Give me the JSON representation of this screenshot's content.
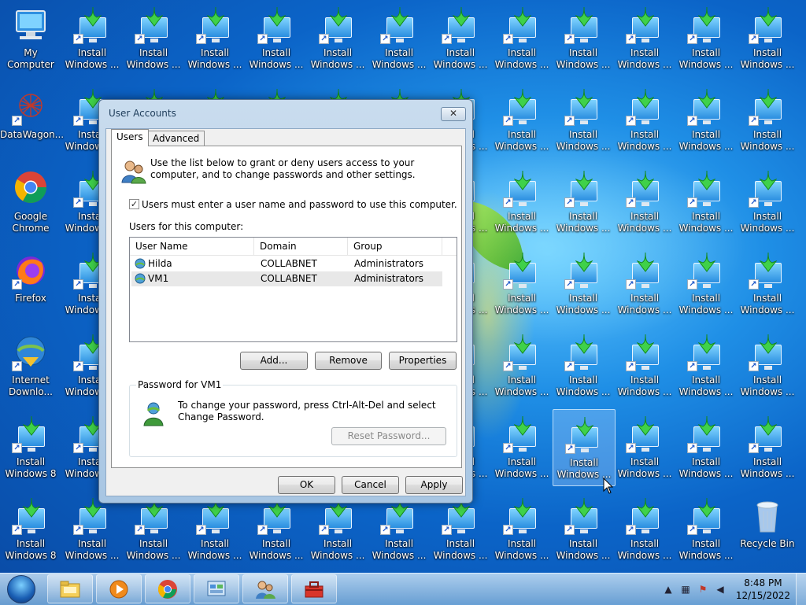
{
  "desktop": {
    "icons": [
      {
        "id": "my-computer",
        "label": "My Computer",
        "col": 0,
        "row": 0,
        "type": "computer"
      },
      {
        "id": "datawagon",
        "label": "DataWagon...",
        "col": 0,
        "row": 1,
        "type": "datawagon"
      },
      {
        "id": "google-chrome",
        "label": "Google Chrome",
        "col": 0,
        "row": 2,
        "type": "chrome"
      },
      {
        "id": "firefox",
        "label": "Firefox",
        "col": 0,
        "row": 3,
        "type": "firefox"
      },
      {
        "id": "internet-download",
        "label": "Internet Downlo...",
        "col": 0,
        "row": 4,
        "type": "idm"
      },
      {
        "id": "install-win8-a",
        "label": "Install Windows 8",
        "col": 0,
        "row": 5,
        "type": "install"
      },
      {
        "id": "install-win8-b",
        "label": "Install Windows 8",
        "col": 0,
        "row": 6,
        "type": "install",
        "shortcut": true
      },
      {
        "id": "recycle-bin",
        "label": "Recycle Bin",
        "col": 12,
        "row": 6,
        "type": "recycle"
      }
    ],
    "install_label": "Install Windows ...",
    "selected_icon": {
      "col": 9,
      "row": 5
    }
  },
  "dialog": {
    "title": "User Accounts",
    "close_glyph": "✕",
    "tabs": [
      {
        "label": "Users",
        "active": true
      },
      {
        "label": "Advanced",
        "active": false
      }
    ],
    "intro_text": "Use the list below to grant or deny users access to your computer, and to change passwords and other settings.",
    "must_login_checkbox": {
      "label": "Users must enter a user name and password to use this computer.",
      "checked": true,
      "glyph": "✓"
    },
    "users_list_label": "Users for this computer:",
    "columns": [
      "User Name",
      "Domain",
      "Group"
    ],
    "users": [
      {
        "name": "Hilda",
        "domain": "COLLABNET",
        "group": "Administrators",
        "selected": false
      },
      {
        "name": "VM1",
        "domain": "COLLABNET",
        "group": "Administrators",
        "selected": true
      }
    ],
    "buttons": {
      "add": "Add...",
      "remove": "Remove",
      "properties": "Properties",
      "reset_password": "Reset Password...",
      "ok": "OK",
      "cancel": "Cancel",
      "apply": "Apply"
    },
    "password_group_title": "Password for VM1",
    "password_text": "To change your password, press Ctrl-Alt-Del and select Change Password."
  },
  "taskbar": {
    "buttons": [
      {
        "name": "explorer",
        "icon": "folder-icon"
      },
      {
        "name": "media-player",
        "icon": "media-player-icon"
      },
      {
        "name": "chrome",
        "icon": "chrome-icon"
      },
      {
        "name": "control-panel",
        "icon": "control-panel-icon"
      },
      {
        "name": "user-accounts",
        "icon": "users-icon"
      },
      {
        "name": "toolbox",
        "icon": "toolbox-icon"
      }
    ],
    "clock": {
      "time": "8:48 PM",
      "date": "12/15/2022"
    },
    "tray_icons": [
      "show-hidden-icons",
      "network-icon",
      "action-center-icon",
      "volume-icon"
    ]
  }
}
